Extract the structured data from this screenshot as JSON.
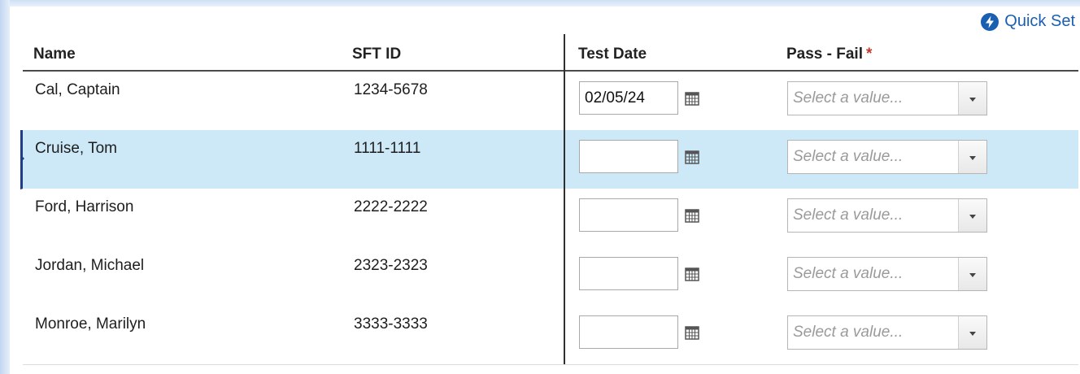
{
  "quick_set": {
    "label": "Quick Set"
  },
  "columns": {
    "name": "Name",
    "sft_id": "SFT ID",
    "test_date": "Test Date",
    "pass_fail": "Pass - Fail",
    "required_mark": "*"
  },
  "rows": [
    {
      "name": "Cal, Captain",
      "sft_id": "1234-5678",
      "test_date": "02/05/24",
      "pass_fail_placeholder": "Select a value...",
      "selected": false
    },
    {
      "name": "Cruise, Tom",
      "sft_id": "1111-1111",
      "test_date": "",
      "pass_fail_placeholder": "Select a value...",
      "selected": true
    },
    {
      "name": "Ford, Harrison",
      "sft_id": "2222-2222",
      "test_date": "",
      "pass_fail_placeholder": "Select a value...",
      "selected": false
    },
    {
      "name": "Jordan, Michael",
      "sft_id": "2323-2323",
      "test_date": "",
      "pass_fail_placeholder": "Select a value...",
      "selected": false
    },
    {
      "name": "Monroe, Marilyn",
      "sft_id": "3333-3333",
      "test_date": "",
      "pass_fail_placeholder": "Select a value...",
      "selected": false
    }
  ],
  "colors": {
    "accent": "#1b5fb0",
    "selected_row": "#cde9f8",
    "required": "#c0392b"
  },
  "icons": {
    "quick_set": "lightning-bolt-icon",
    "calendar": "calendar-icon",
    "dropdown": "chevron-down-icon"
  }
}
